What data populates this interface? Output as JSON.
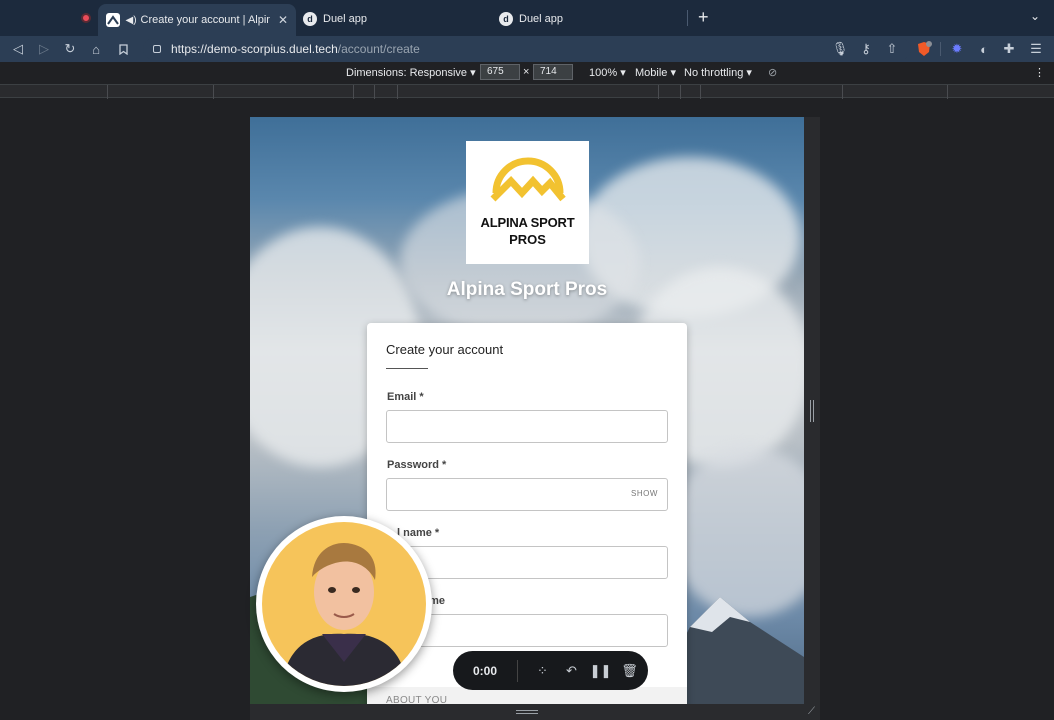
{
  "browser": {
    "tabs": [
      {
        "title": "Create your account | Alpina Sport Pros",
        "active": true
      },
      {
        "title": "Duel app",
        "active": false
      },
      {
        "title": "Duel app",
        "active": false
      }
    ],
    "new_tab_symbol": "+",
    "url": {
      "origin": "https://demo-scorpius.duel.tech",
      "path": "/account/create"
    }
  },
  "devtools": {
    "dimensions_label": "Dimensions: Responsive",
    "width": "675",
    "times": "×",
    "height": "714",
    "zoom": "100%",
    "device": "Mobile",
    "throttling": "No throttling"
  },
  "page": {
    "logo_line1": "ALPINA SPORT",
    "logo_line2": "PROS",
    "brand_name": "Alpina Sport Pros",
    "form": {
      "title": "Create your account",
      "email_label": "Email *",
      "password_label": "Password *",
      "password_toggle": "SHOW",
      "fullname_label": "l name *",
      "username_label": "ame",
      "section_about": "ABOUT YOU"
    }
  },
  "recorder": {
    "time": "0:00"
  },
  "colors": {
    "tab_bar": "#1c2a3d",
    "nav_bar": "#2c3e55",
    "logo_yellow": "#f2c230",
    "avatar_bg": "#f6c45a"
  }
}
